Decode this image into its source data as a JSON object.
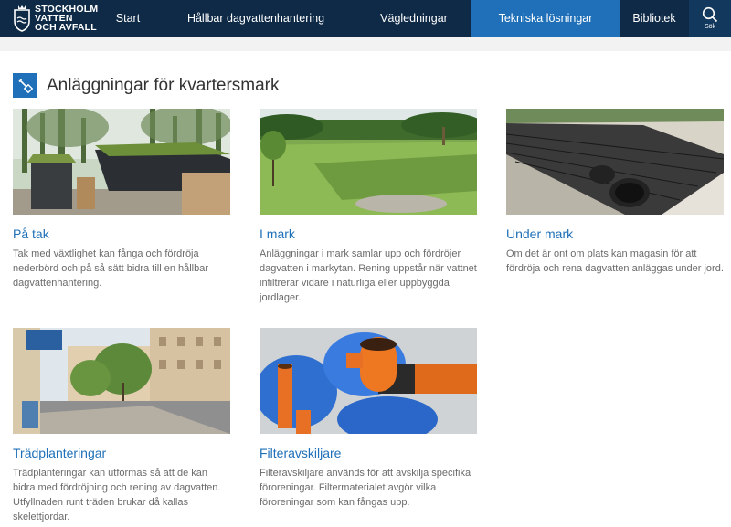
{
  "header": {
    "logo_lines": [
      "STOCKHOLM",
      "VATTEN",
      "OCH AVFALL"
    ],
    "nav": [
      {
        "label": "Start"
      },
      {
        "label": "Hållbar dagvattenhantering"
      },
      {
        "label": "Vägledningar"
      },
      {
        "label": "Tekniska lösningar",
        "active": true
      },
      {
        "label": "Bibliotek"
      }
    ],
    "search_label": "Sök",
    "colors": {
      "bar": "#0e2a47",
      "active": "#1f70b8"
    }
  },
  "page": {
    "heading": "Anläggningar för kvartersmark",
    "heading_icon": "shovel-icon"
  },
  "cards": [
    {
      "title": "På tak",
      "image": "green-roof-photo",
      "description": "Tak med växtlighet kan fånga och fördröja nederbörd och på så sätt bidra till en hållbar dagvattenhantering."
    },
    {
      "title": "I mark",
      "image": "grass-swale-photo",
      "description": "Anläggningar i mark samlar upp och fördröjer dagvatten i markytan. Rening uppstår när vattnet infiltrerar vidare i naturliga eller uppbyggda jordlager."
    },
    {
      "title": "Under mark",
      "image": "underground-pipes-photo",
      "description": "Om det är ont om plats kan magasin för att fördröja och rena dagvatten anläggas under jord."
    },
    {
      "title": "Trädplanteringar",
      "image": "street-trees-photo",
      "description": "Trädplanteringar kan utformas så att de kan bidra med fördröjning och rening av dagvatten. Utfyllnaden runt träden brukar då kallas skelettjordar."
    },
    {
      "title": "Filteravskiljare",
      "image": "filter-separator-photo",
      "description": "Filteravskiljare används för att avskilja specifika föroreningar. Filtermaterialet avgör vilka föroreningar som kan fångas upp."
    }
  ]
}
